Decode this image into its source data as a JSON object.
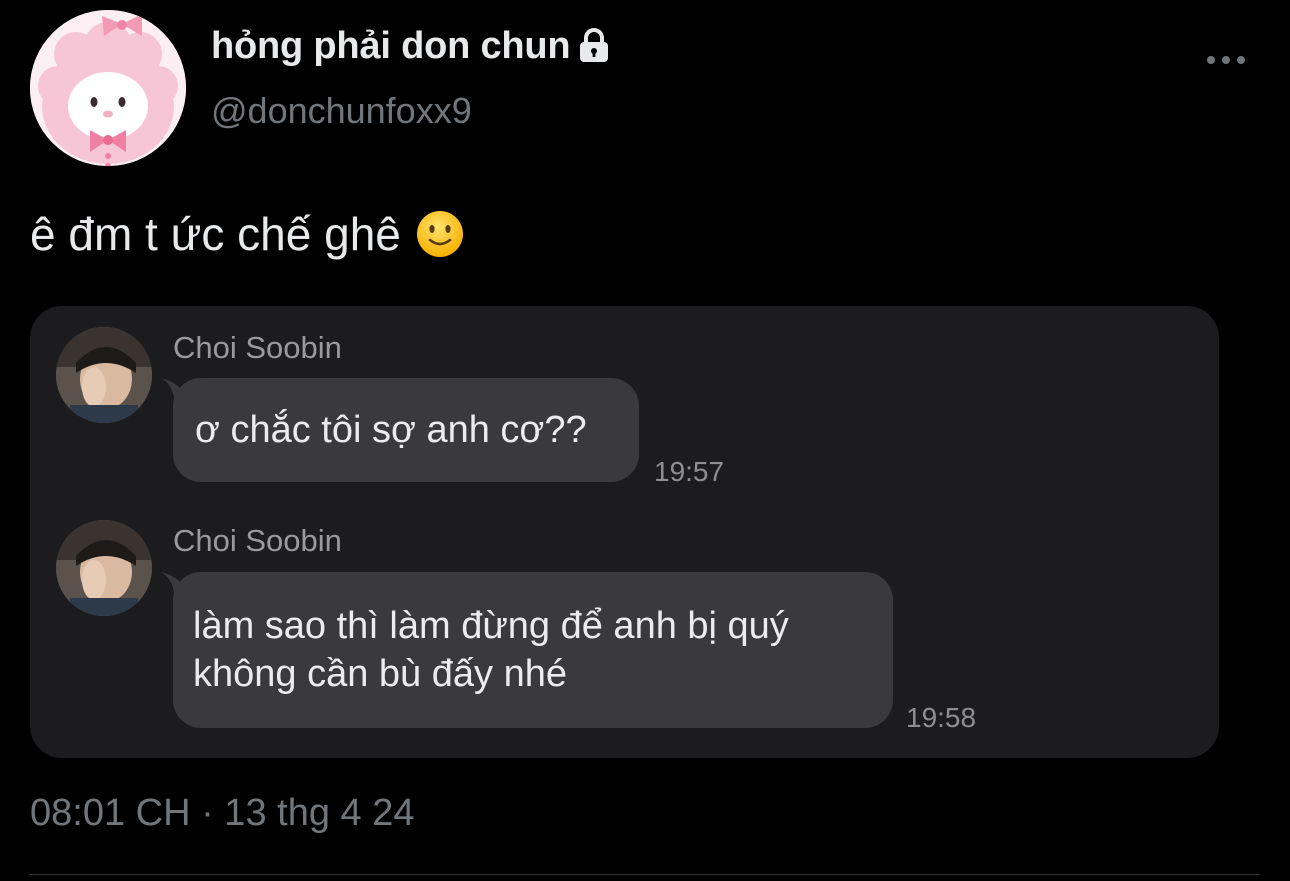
{
  "author": {
    "display_name": "hỏng phải don chun",
    "handle": "@donchunfoxx9",
    "avatar_icon": "my-melody-avatar",
    "protected_icon": "lock-icon"
  },
  "menu": {
    "icon": "more-horizontal-icon"
  },
  "tweet": {
    "text": "ê đm t ức chế ghê",
    "emoji_icon": "slightly-smiling-face-icon"
  },
  "chat": {
    "messages": [
      {
        "sender": "Choi Soobin",
        "lines": [
          "ơ chắc tôi sợ anh cơ??"
        ],
        "time": "19:57"
      },
      {
        "sender": "Choi Soobin",
        "lines": [
          "làm sao thì làm đừng để anh bị quý",
          "không cần bù đấy nhé"
        ],
        "time": "19:58"
      }
    ]
  },
  "meta": {
    "timestamp": "08:01 CH · 13 thg 4 24"
  },
  "colors": {
    "background": "#000000",
    "primary_text": "#e7e9ea",
    "secondary_text": "#71767b",
    "card_background": "#1c1c1e",
    "bubble_background": "#3a3a3c"
  }
}
